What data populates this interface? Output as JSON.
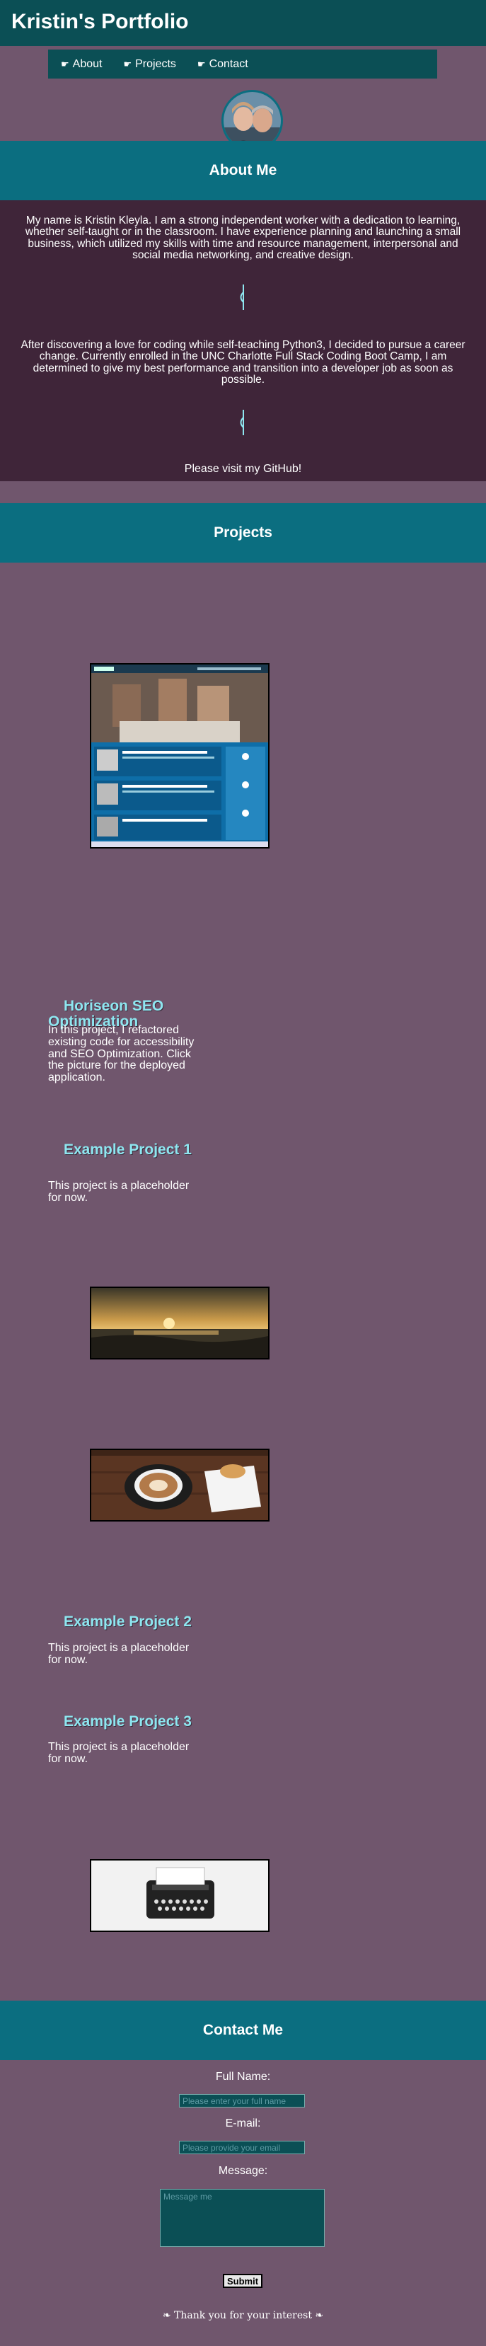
{
  "header": {
    "title": "Kristin's Portfolio"
  },
  "nav": {
    "items": [
      {
        "icon": "pointing-hand-icon",
        "label": "About"
      },
      {
        "icon": "pointing-hand-icon",
        "label": "Projects"
      },
      {
        "icon": "pointing-hand-icon",
        "label": "Contact"
      }
    ]
  },
  "about": {
    "title": "About Me",
    "paragraph1": "My name is Kristin Kleyla. I am a strong independent worker with a dedication to learning, whether self-taught or in the classroom. I have experience planning and launching a small business, which utilized my skills with time and resource management, interpersonal and social media networking, and creative design.",
    "paragraph2": "After discovering a love for coding while self-teaching Python3, I decided to pursue a career change. Currently enrolled in the UNC Charlotte Full Stack Coding Boot Camp, I am determined to give my best performance and transition into a developer job as soon as possible.",
    "github": "Please visit my GitHub!"
  },
  "projects": {
    "title": "Projects",
    "items": [
      {
        "title": "Horiseon SEO Optimization",
        "description": "In this project, I refactored existing code for accessibility and SEO Optimization. Click the picture for the deployed application."
      },
      {
        "title": "Example Project 1",
        "description": "This project is a placeholder for now."
      },
      {
        "title": "Example Project 2",
        "description": "This project is a placeholder for now."
      },
      {
        "title": "Example Project 3",
        "description": "This project is a placeholder for now."
      }
    ]
  },
  "contact": {
    "title": "Contact Me",
    "name_label": "Full Name:",
    "name_placeholder": "Please enter your full name",
    "email_label": "E-mail:",
    "email_placeholder": "Please provide your email",
    "message_label": "Message:",
    "message_placeholder": "Message me",
    "submit_label": "Submit",
    "thanks": "❧ Thank you for your interest ❧"
  },
  "colors": {
    "page_bg": "#70566d",
    "header_bg": "#0b4f55",
    "band_bg": "#0b6e80",
    "about_bg": "#3f2539",
    "accent_text": "#8ee6f0"
  }
}
